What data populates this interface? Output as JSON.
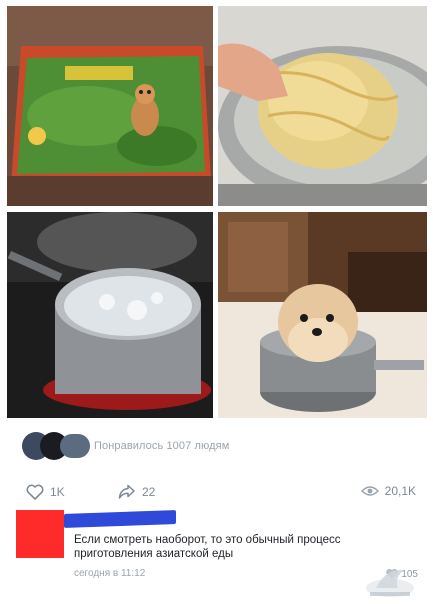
{
  "post": {
    "likes_text": "Понравилось 1007 людям",
    "actions": {
      "like_count": "1K",
      "share_count": "22",
      "views_count": "20,1K"
    }
  },
  "comment": {
    "text": "Если смотреть наоборот, то это обычный процесс приготовления азиатской еды",
    "time": "сегодня в 11:12",
    "likes": "105"
  },
  "images": [
    {
      "name": "noodle-package-with-puppy"
    },
    {
      "name": "hand-with-noodles-in-pot"
    },
    {
      "name": "boiling-water-pot"
    },
    {
      "name": "puppy-in-saucepan"
    }
  ],
  "icons": [
    "heart-icon",
    "share-icon",
    "eye-icon",
    "comment-like-icon"
  ],
  "colors": {
    "name_redaction": "#2f49d8",
    "avatar_redaction": "#ff2a2a",
    "meta_text": "#9aa3ad"
  }
}
